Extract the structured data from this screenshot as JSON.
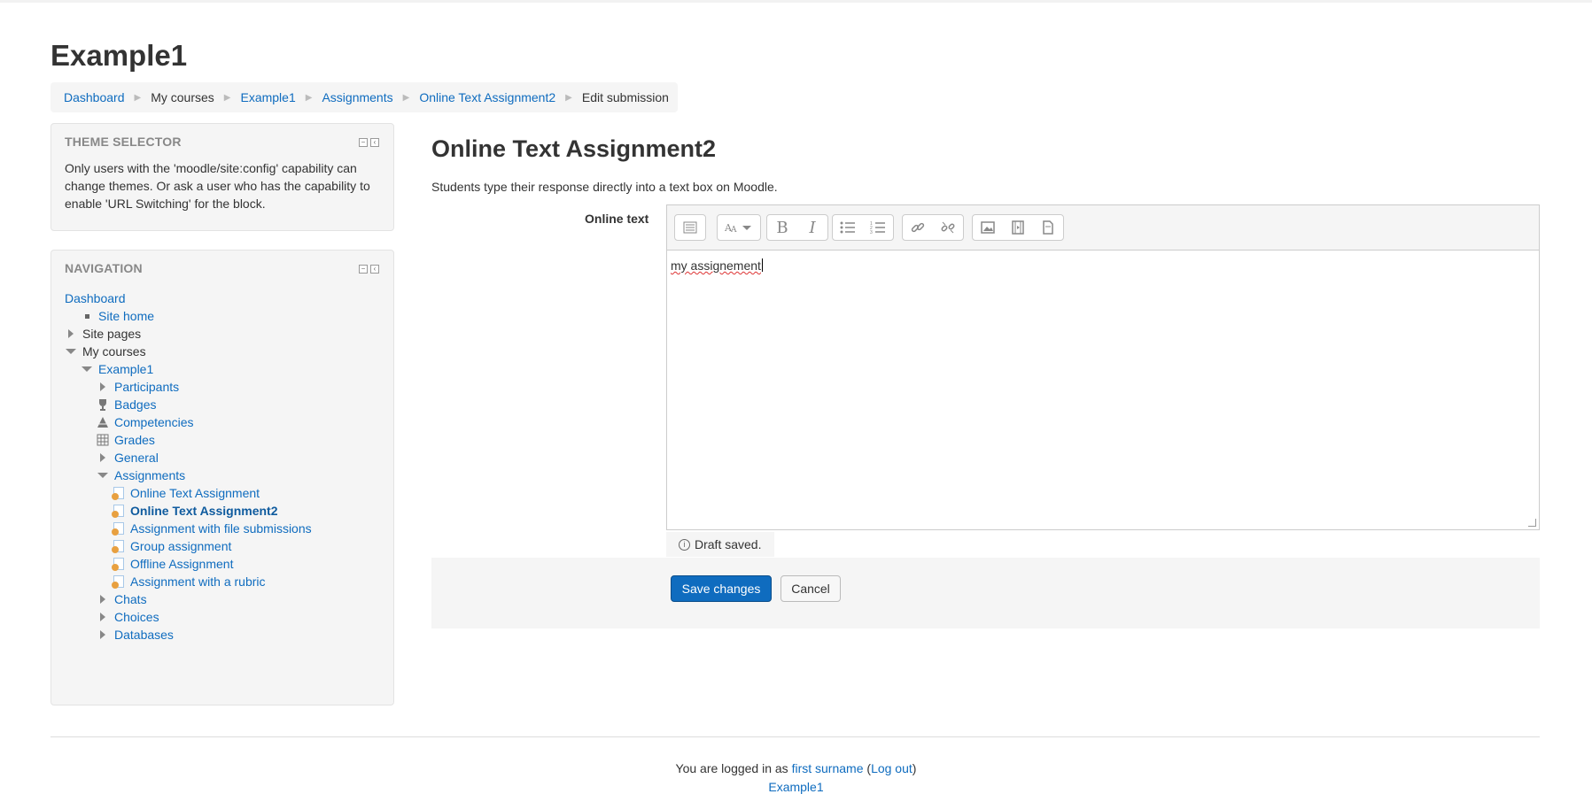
{
  "page": {
    "title": "Example1"
  },
  "breadcrumb": [
    {
      "label": "Dashboard",
      "link": true
    },
    {
      "label": "My courses",
      "link": false
    },
    {
      "label": "Example1",
      "link": true
    },
    {
      "label": "Assignments",
      "link": true
    },
    {
      "label": "Online Text Assignment2",
      "link": true
    },
    {
      "label": "Edit submission",
      "link": false
    }
  ],
  "theme_block": {
    "title": "THEME SELECTOR",
    "text": "Only users with the 'moodle/site:config' capability can change themes. Or ask a user who has the capability to enable 'URL Switching' for the block."
  },
  "navigation": {
    "title": "NAVIGATION",
    "items": [
      {
        "label": "Dashboard",
        "icon": "none",
        "link": true
      },
      {
        "label": "Site home",
        "icon": "square-bullet-icon",
        "link": true
      },
      {
        "label": "Site pages",
        "icon": "expand-arrow-icon",
        "link": false
      },
      {
        "label": "My courses",
        "icon": "collapse-arrow-icon",
        "link": false
      },
      {
        "label": "Example1",
        "icon": "collapse-arrow-icon",
        "link": true
      },
      {
        "label": "Participants",
        "icon": "expand-arrow-icon",
        "link": true
      },
      {
        "label": "Badges",
        "icon": "trophy-icon",
        "link": true
      },
      {
        "label": "Competencies",
        "icon": "competency-icon",
        "link": true
      },
      {
        "label": "Grades",
        "icon": "grades-table-icon",
        "link": true
      },
      {
        "label": "General",
        "icon": "expand-arrow-icon",
        "link": true
      },
      {
        "label": "Assignments",
        "icon": "collapse-arrow-icon",
        "link": true
      },
      {
        "label": "Online Text Assignment",
        "icon": "assignment-icon",
        "link": true
      },
      {
        "label": "Online Text Assignment2",
        "icon": "assignment-icon",
        "link": true,
        "current": true
      },
      {
        "label": "Assignment with file submissions",
        "icon": "assignment-icon",
        "link": true
      },
      {
        "label": "Group assignment",
        "icon": "assignment-icon",
        "link": true
      },
      {
        "label": "Offline Assignment",
        "icon": "assignment-icon",
        "link": true
      },
      {
        "label": "Assignment with a rubric",
        "icon": "assignment-icon",
        "link": true
      },
      {
        "label": "Chats",
        "icon": "expand-arrow-icon",
        "link": true
      },
      {
        "label": "Choices",
        "icon": "expand-arrow-icon",
        "link": true
      },
      {
        "label": "Databases",
        "icon": "expand-arrow-icon",
        "link": true
      }
    ]
  },
  "main": {
    "title": "Online Text Assignment2",
    "description": "Students type their response directly into a text box on Moodle.",
    "field_label": "Online text",
    "editor": {
      "toolbar_icons": [
        "toolbar-toggle-icon",
        "font-style-icon",
        "bold-icon",
        "italic-icon",
        "unordered-list-icon",
        "ordered-list-icon",
        "link-icon",
        "unlink-icon",
        "image-icon",
        "media-icon",
        "manage-files-icon"
      ],
      "content": "my assignement"
    },
    "draft_status": "Draft saved.",
    "save_label": "Save changes",
    "cancel_label": "Cancel"
  },
  "footer": {
    "logged_in_prefix": "You are logged in as",
    "user_name": "first surname",
    "logout_label": "Log out",
    "course_link": "Example1"
  },
  "colors": {
    "link": "#0f6cbf",
    "primary_button": "#0f6cbf",
    "block_bg": "#f5f5f5"
  }
}
